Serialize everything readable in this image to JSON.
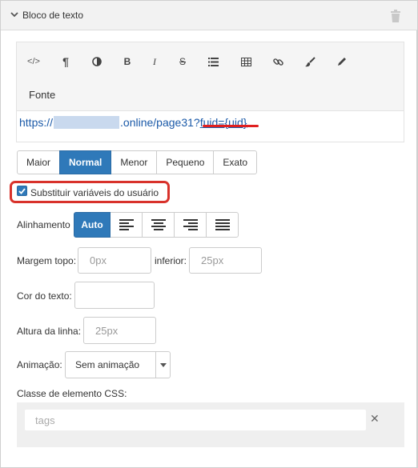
{
  "panel": {
    "title": "Bloco de texto"
  },
  "toolbar": {
    "buttons": [
      {
        "icon": "code-icon",
        "glyph": "</>"
      },
      {
        "icon": "paragraph-icon",
        "glyph": "¶"
      },
      {
        "icon": "contrast-icon",
        "glyph": "◑"
      },
      {
        "icon": "bold-icon",
        "glyph": "B"
      },
      {
        "icon": "italic-icon",
        "glyph": "I"
      },
      {
        "icon": "strikethrough-icon",
        "glyph": "S"
      },
      {
        "icon": "list-icon",
        "glyph": "☰"
      },
      {
        "icon": "table-icon",
        "glyph": "▦"
      },
      {
        "icon": "link-icon",
        "glyph": "🔗"
      },
      {
        "icon": "brush-icon",
        "glyph": "🖌"
      },
      {
        "icon": "pencil-icon",
        "glyph": "✎"
      }
    ],
    "font_label": "Fonte"
  },
  "content": {
    "prefix": "https://",
    "middle": ".online/page31?",
    "param": "fuid={uid}"
  },
  "sizes": {
    "options": [
      "Maior",
      "Normal",
      "Menor",
      "Pequeno",
      "Exato"
    ],
    "selected": "Normal"
  },
  "substitute": {
    "label": "Substituir variáveis do usuário",
    "checked": true
  },
  "alignment": {
    "label": "Alinhamento",
    "auto_label": "Auto"
  },
  "margin": {
    "top_label": "Margem topo:",
    "top_placeholder": "0px",
    "bottom_label": "inferior:",
    "bottom_placeholder": "25px"
  },
  "text_color": {
    "label": "Cor do texto:"
  },
  "line_height": {
    "label": "Altura da linha:",
    "placeholder": "25px"
  },
  "animation": {
    "label": "Animação:",
    "value": "Sem animação"
  },
  "css_class": {
    "label": "Classe de elemento CSS:",
    "placeholder": "tags"
  },
  "colors": {
    "accent": "#2f79b9",
    "link": "#1a59a8",
    "highlight": "#d8322b"
  }
}
